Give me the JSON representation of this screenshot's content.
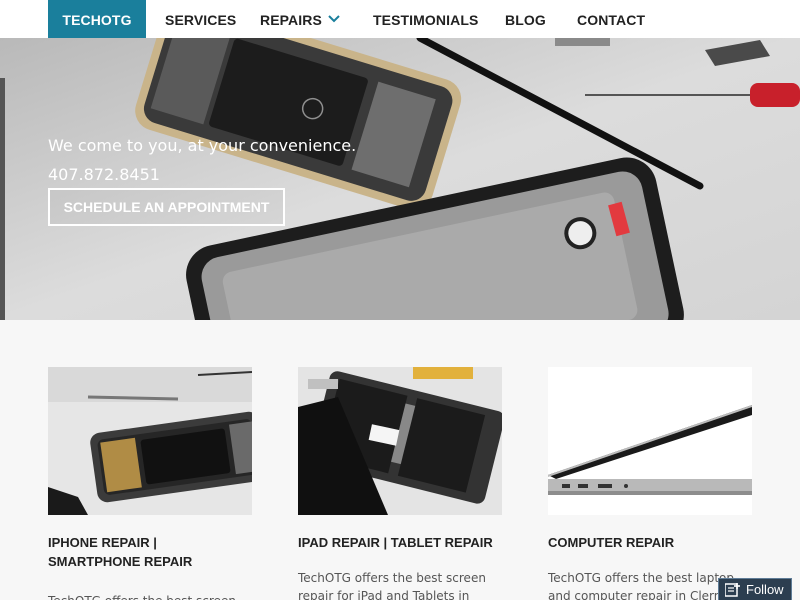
{
  "nav": {
    "brand": "TECHOTG",
    "items": {
      "services": "SERVICES",
      "repairs": "REPAIRS",
      "testimonials": "TESTIMONIALS",
      "blog": "BLOG",
      "contact": "CONTACT"
    },
    "brand_color": "#1a7f9c"
  },
  "hero": {
    "tagline": "We come to you, at your convenience.",
    "phone": "407.872.8451",
    "cta_label": "SCHEDULE AN APPOINTMENT"
  },
  "services": [
    {
      "title_line1": "IPHONE REPAIR |",
      "title_line2": "SMARTPHONE REPAIR",
      "text": "TechOTG offers the best screen repair"
    },
    {
      "title": "IPAD REPAIR | TABLET REPAIR",
      "text": "TechOTG offers the best screen repair for iPad and Tablets in Clermont and"
    },
    {
      "title": "COMPUTER REPAIR",
      "text": "TechOTG offers the best laptop and computer repair in Clermont and"
    }
  ],
  "follow": {
    "label": "Follow",
    "icon": "follow-plus-icon"
  }
}
